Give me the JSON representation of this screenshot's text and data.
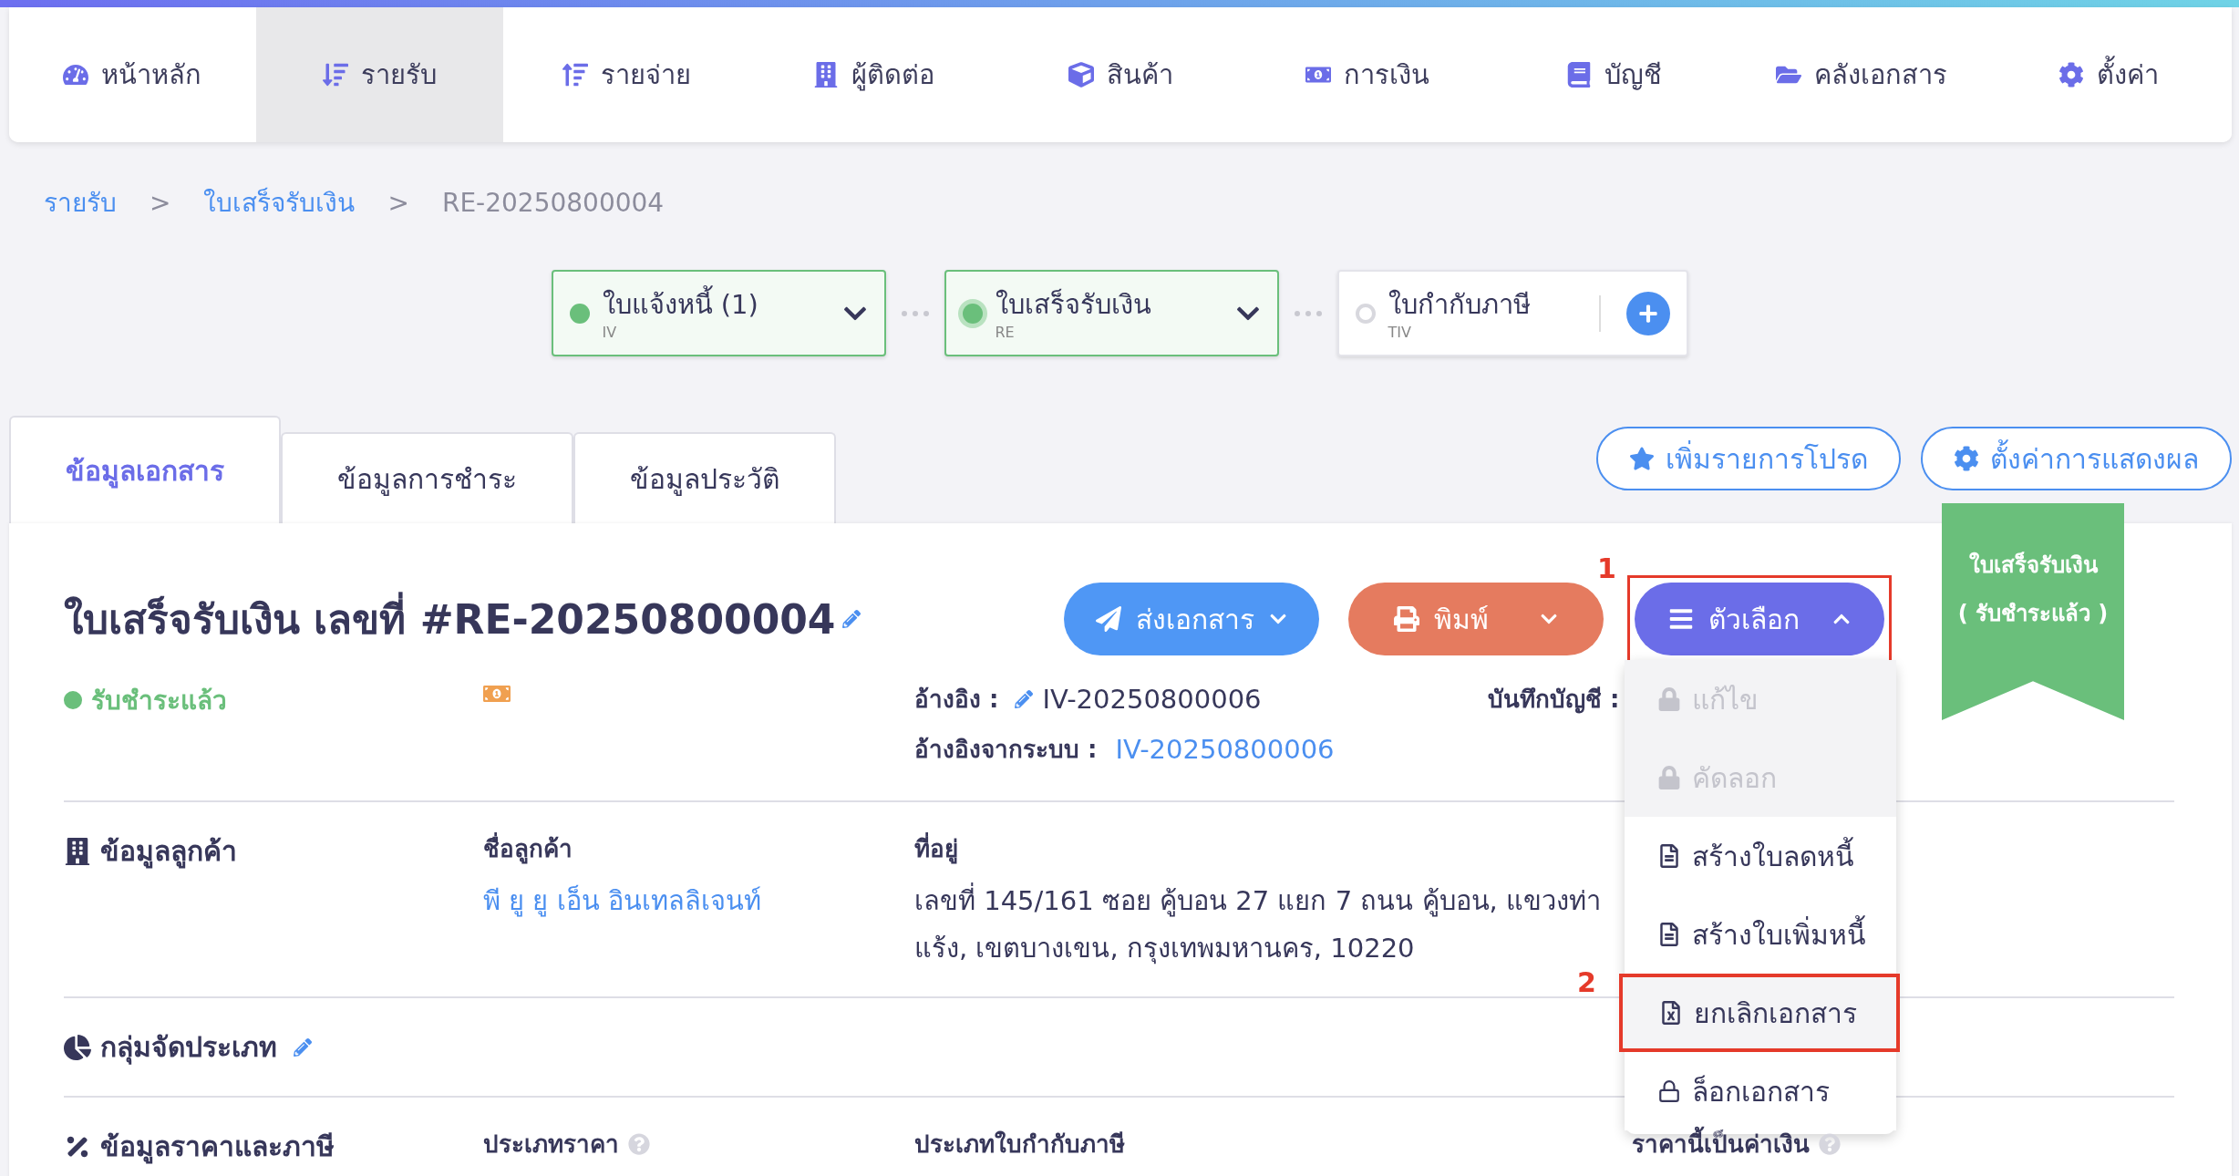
{
  "nav": [
    {
      "label": "หน้าหลัก",
      "kind": "dashboard",
      "selected": false
    },
    {
      "label": "รายรับ",
      "kind": "income",
      "selected": true
    },
    {
      "label": "รายจ่าย",
      "kind": "expense",
      "selected": false
    },
    {
      "label": "ผู้ติดต่อ",
      "kind": "contacts",
      "selected": false
    },
    {
      "label": "สินค้า",
      "kind": "product",
      "selected": false
    },
    {
      "label": "การเงิน",
      "kind": "finance",
      "selected": false
    },
    {
      "label": "บัญชี",
      "kind": "accounting",
      "selected": false
    },
    {
      "label": "คลังเอกสาร",
      "kind": "documents",
      "selected": false
    },
    {
      "label": "ตั้งค่า",
      "kind": "settings",
      "selected": false
    }
  ],
  "breadcrumb": {
    "items": [
      {
        "label": "รายรับ",
        "link": true
      },
      {
        "label": "ใบเสร็จรับเงิน",
        "link": true
      },
      {
        "label": "RE-20250800004",
        "link": false
      }
    ],
    "separators": [
      ">",
      ">"
    ]
  },
  "flow": [
    {
      "label": "ใบแจ้งหนี้ (1)",
      "code": "IV",
      "done": true,
      "selected": false,
      "kind": "dropdown"
    },
    {
      "label": "ใบเสร็จรับเงิน",
      "code": "RE",
      "done": true,
      "selected": true,
      "kind": "dropdown"
    },
    {
      "label": "ใบกำกับภาษี",
      "code": "TIV",
      "done": false,
      "selected": false,
      "kind": "add"
    }
  ],
  "tabs": [
    {
      "label": "ข้อมูลเอกสาร",
      "selected": true
    },
    {
      "label": "ข้อมูลการชำระ",
      "selected": false
    },
    {
      "label": "ข้อมูลประวัติ",
      "selected": false
    }
  ],
  "top_buttons": [
    {
      "label": "เพิ่มรายการโปรด",
      "kind": "favorite"
    },
    {
      "label": "ตั้งค่าการแสดงผล",
      "kind": "settings"
    }
  ],
  "ribbon": {
    "title": "ใบเสร็จรับเงิน",
    "subtitle": "( รับชำระแล้ว )"
  },
  "document": {
    "title": "ใบเสร็จรับเงิน เลขที่ #RE-20250800004",
    "actions": [
      {
        "label": "ส่งเอกสาร",
        "kind": "send"
      },
      {
        "label": "พิมพ์",
        "kind": "print"
      }
    ],
    "options": {
      "label": "ตัวเลือก",
      "expanded": true,
      "annotation": "1"
    },
    "menu": [
      {
        "label": "แก้ไข",
        "kind": "locked",
        "disabled": true,
        "highlighted": false
      },
      {
        "label": "คัดลอก",
        "kind": "locked",
        "disabled": true,
        "highlighted": false
      },
      {
        "label": "สร้างใบลดหนี้",
        "kind": "document",
        "disabled": false,
        "highlighted": false
      },
      {
        "label": "สร้างใบเพิ่มหนี้",
        "kind": "document",
        "disabled": false,
        "highlighted": false
      },
      {
        "label": "ยกเลิกเอกสาร",
        "kind": "cancel",
        "disabled": false,
        "highlighted": true,
        "annotation": "2"
      },
      {
        "label": "ล็อกเอกสาร",
        "kind": "lock",
        "disabled": false,
        "highlighted": false
      }
    ],
    "status": {
      "label": "รับชำระแล้ว",
      "color": "#6abf7b"
    },
    "reference": {
      "label": "อ้างอิง :",
      "value": "IV-20250800006"
    },
    "system_reference": {
      "label": "อ้างอิงจากระบบ :",
      "value": "IV-20250800006"
    },
    "journal": {
      "label": "บันทึกบัญชี :"
    },
    "customer": {
      "heading": "ข้อมูลลูกค้า",
      "name_label": "ชื่อลูกค้า",
      "name": "พี ยู ยู เอ็น อินเทลลิเจนท์",
      "address_label": "ที่อยู่",
      "address_lines": [
        "เลขที่ 145/161 ซอย คู้บอน 27 แยก 7 ถนน คู้บอน, แขวงท่า",
        "แร้ง, เขตบางเขน, กรุงเทพมหานคร, 10220"
      ]
    },
    "classification": {
      "heading": "กลุ่มจัดประเภท"
    },
    "pricing": {
      "heading": "ข้อมูลราคาและภาษี",
      "columns": [
        {
          "label": "ประเภทราคา",
          "help": true
        },
        {
          "label": "ประเภทใบกำกับภาษี",
          "help": false
        },
        {
          "label": "ราคานี้เป็นค่าเงิน",
          "help": true
        }
      ]
    }
  }
}
